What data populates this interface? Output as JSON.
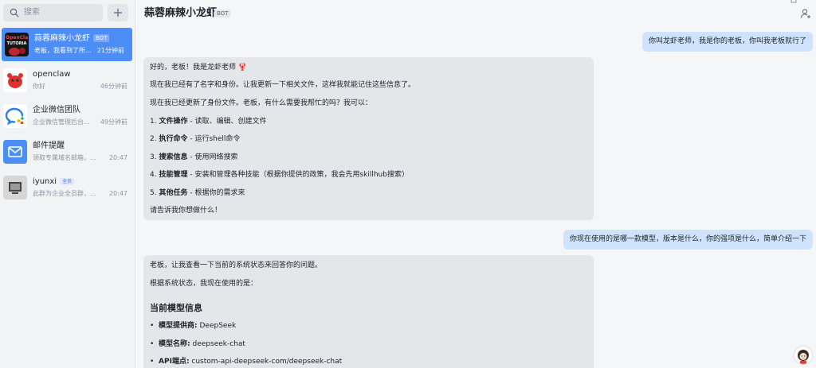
{
  "sidebar": {
    "search_placeholder": "搜索",
    "conversations": [
      {
        "name": "蒜蓉麻辣小龙虾",
        "badge": "BOT",
        "snippet": "老板，我看到了所...",
        "time": "21分钟前"
      },
      {
        "name": "openclaw",
        "snippet": "你好",
        "time": "46分钟前"
      },
      {
        "name": "企业微信团队",
        "snippet": "企业微信管理后台...",
        "time": "49分钟前"
      },
      {
        "name": "邮件提醒",
        "snippet": "领取专属域名邮箱，...",
        "time": "20:47"
      },
      {
        "name": "iyunxi",
        "badge": "全员",
        "snippet": "此群为企业全员群，...",
        "time": "20:47"
      }
    ],
    "avatar_1_text": [
      "OpenCla",
      "TUTORIA"
    ]
  },
  "chat": {
    "title": "蒜蓉麻辣小龙虾",
    "title_badge": "BOT",
    "messages": {
      "out1": "你叫龙虾老师，我是你的老板，你叫我老板就行了",
      "in1": {
        "greeting": "好的，老板！我是龙虾老师 🦞",
        "p1": "现在我已经有了名字和身份。让我更新一下相关文件，这样我就能记住这些信息了。",
        "p2": "现在我已经更新了身份文件。老板，有什么需要我帮忙的吗？我可以：",
        "items": [
          {
            "num": "1.",
            "bold": "文件操作",
            "rest": " - 读取、编辑、创建文件"
          },
          {
            "num": "2.",
            "bold": "执行命令",
            "rest": " - 运行shell命令"
          },
          {
            "num": "3.",
            "bold": "搜索信息",
            "rest": " - 使用网络搜索"
          },
          {
            "num": "4.",
            "bold": "技能管理",
            "rest": " - 安装和管理各种技能（根据你提供的政策，我会先用skillhub搜索）"
          },
          {
            "num": "5.",
            "bold": "其他任务",
            "rest": " - 根据你的需求来"
          }
        ],
        "closing": "请告诉我你想做什么！"
      },
      "out2": "你现在使用的是哪一款模型，版本是什么，你的强项是什么，简单介绍一下",
      "in2": {
        "p1": "老板，让我查看一下当前的系统状态来回答你的问题。",
        "p2": "根据系统状态，我现在使用的是：",
        "heading": "当前模型信息",
        "items": [
          {
            "bold": "模型提供商:",
            "rest": " DeepSeek"
          },
          {
            "bold": "模型名称:",
            "rest": " deepseek-chat"
          },
          {
            "bold": "API端点:",
            "rest": " custom-api-deepseek-com/deepseek-chat"
          }
        ]
      }
    }
  },
  "colors": {
    "active_item": "#4c8df6",
    "outgoing_bubble": "#cfe4fc",
    "incoming_bubble": "#e5e6e9",
    "sidebar_bg": "#f2f3f5",
    "main_bg": "#f5f6f7"
  }
}
